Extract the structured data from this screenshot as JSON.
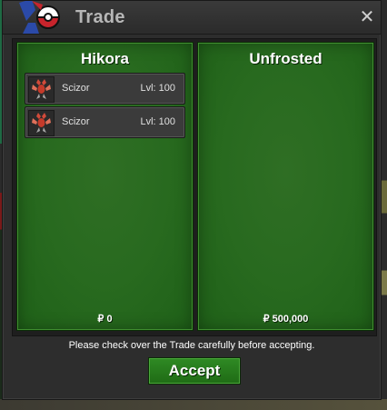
{
  "window": {
    "title": "Trade",
    "close_glyph": "✕"
  },
  "panels": [
    {
      "owner": "Hikora",
      "items": [
        {
          "name": "Scizor",
          "level": "Lvl: 100",
          "icon": "scizor-icon"
        },
        {
          "name": "Scizor",
          "level": "Lvl: 100",
          "icon": "scizor-icon"
        }
      ],
      "money": "₽ 0"
    },
    {
      "owner": "Unfrosted",
      "items": [],
      "money": "₽ 500,000"
    }
  ],
  "notice": "Please check over the Trade carefully before accepting.",
  "accept_label": "Accept",
  "colors": {
    "panel_green": "#286a1f",
    "accept_green": "#2a8020",
    "title_gray": "#b7b7b7"
  }
}
